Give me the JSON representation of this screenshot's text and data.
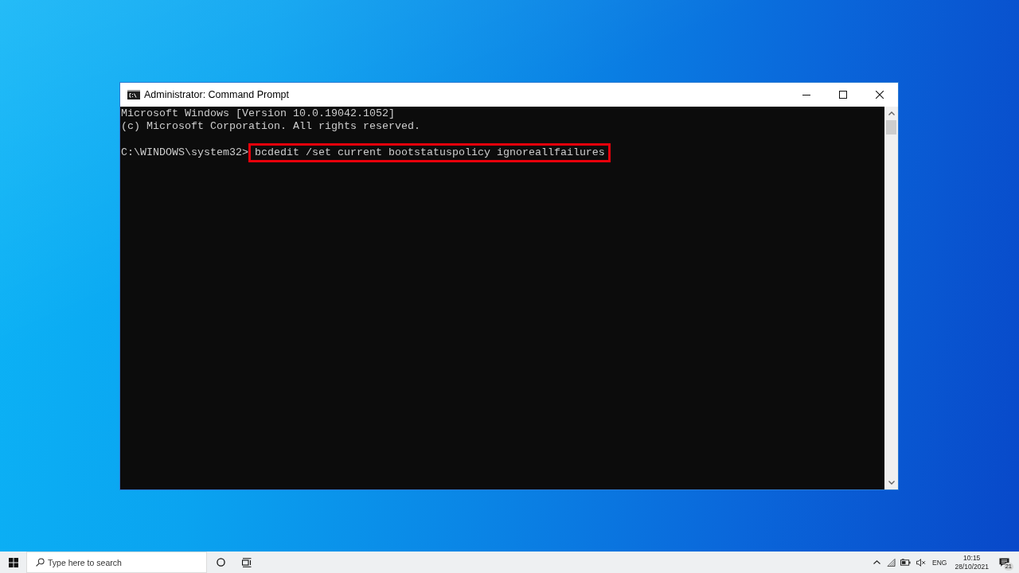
{
  "window": {
    "title": "Administrator: Command Prompt"
  },
  "console": {
    "output": [
      "Microsoft Windows [Version 10.0.19042.1052]",
      "(c) Microsoft Corporation. All rights reserved."
    ],
    "prompt": {
      "path": "C:\\WINDOWS\\system32>",
      "command": "bcdedit /set current bootstatuspolicy ignoreallfailures",
      "highlighted": true
    }
  },
  "taskbar": {
    "search": {
      "placeholder": "Type here to search"
    },
    "tray": {
      "language": "ENG",
      "time": "10:15",
      "date": "28/10/2021",
      "notification_count": "21"
    }
  }
}
